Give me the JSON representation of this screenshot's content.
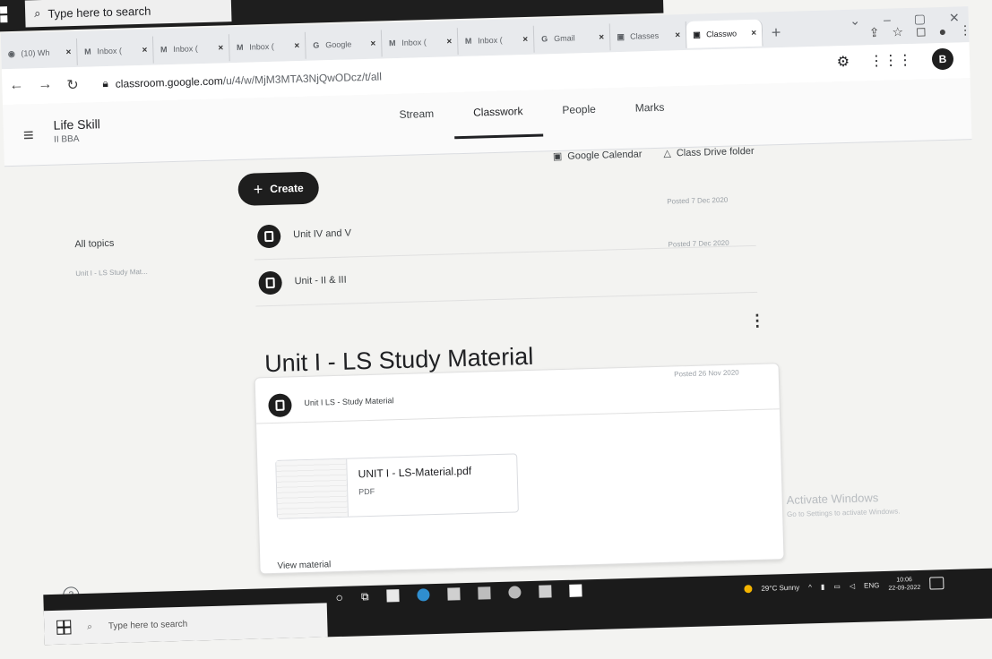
{
  "top_taskbar": {
    "search_placeholder": "Type here to search"
  },
  "tabs": [
    {
      "title": "(10) Wh",
      "icon": "whatsapp-icon"
    },
    {
      "title": "Inbox (",
      "icon": "gmail-icon"
    },
    {
      "title": "Inbox (",
      "icon": "gmail-icon"
    },
    {
      "title": "Inbox (",
      "icon": "gmail-icon"
    },
    {
      "title": "Google",
      "icon": "google-icon"
    },
    {
      "title": "Inbox (",
      "icon": "gmail-icon"
    },
    {
      "title": "Inbox (",
      "icon": "gmail-icon"
    },
    {
      "title": "Gmail",
      "icon": "google-icon"
    },
    {
      "title": "Classes",
      "icon": "classroom-icon"
    },
    {
      "title": "Classwo",
      "icon": "classroom-icon",
      "active": true
    }
  ],
  "address": {
    "domain": "classroom.google.com",
    "path": "/u/4/w/MjM3MTA3NjQwODcz/t/all"
  },
  "account_initial": "B",
  "class": {
    "name": "Life Skill",
    "section": "II BBA"
  },
  "nav_tabs": [
    "Stream",
    "Classwork",
    "People",
    "Marks"
  ],
  "create_label": "Create",
  "toolbar": {
    "calendar": "Google Calendar",
    "drive": "Class Drive folder"
  },
  "topics": {
    "all": "All topics",
    "topic1": "Unit I - LS Study Mat..."
  },
  "items": [
    {
      "title": "Unit IV and V",
      "posted": "Posted 7 Dec 2020"
    },
    {
      "title": "Unit - II & III",
      "posted": "Posted 7 Dec 2020"
    }
  ],
  "topic": {
    "title": "Unit I - LS Study Material",
    "item_title": "Unit I LS - Study Material",
    "item_posted": "Posted 26 Nov 2020",
    "attachment": {
      "name": "UNIT I - LS-Material.pdf",
      "type": "PDF"
    },
    "view_label": "View material"
  },
  "watermark": {
    "line1": "Activate Windows",
    "line2": "Go to Settings to activate Windows."
  },
  "taskbar": {
    "search_placeholder": "Type here to search",
    "weather": "29°C Sunny",
    "lang": "ENG",
    "time": "10:06",
    "date": "22-09-2022"
  }
}
